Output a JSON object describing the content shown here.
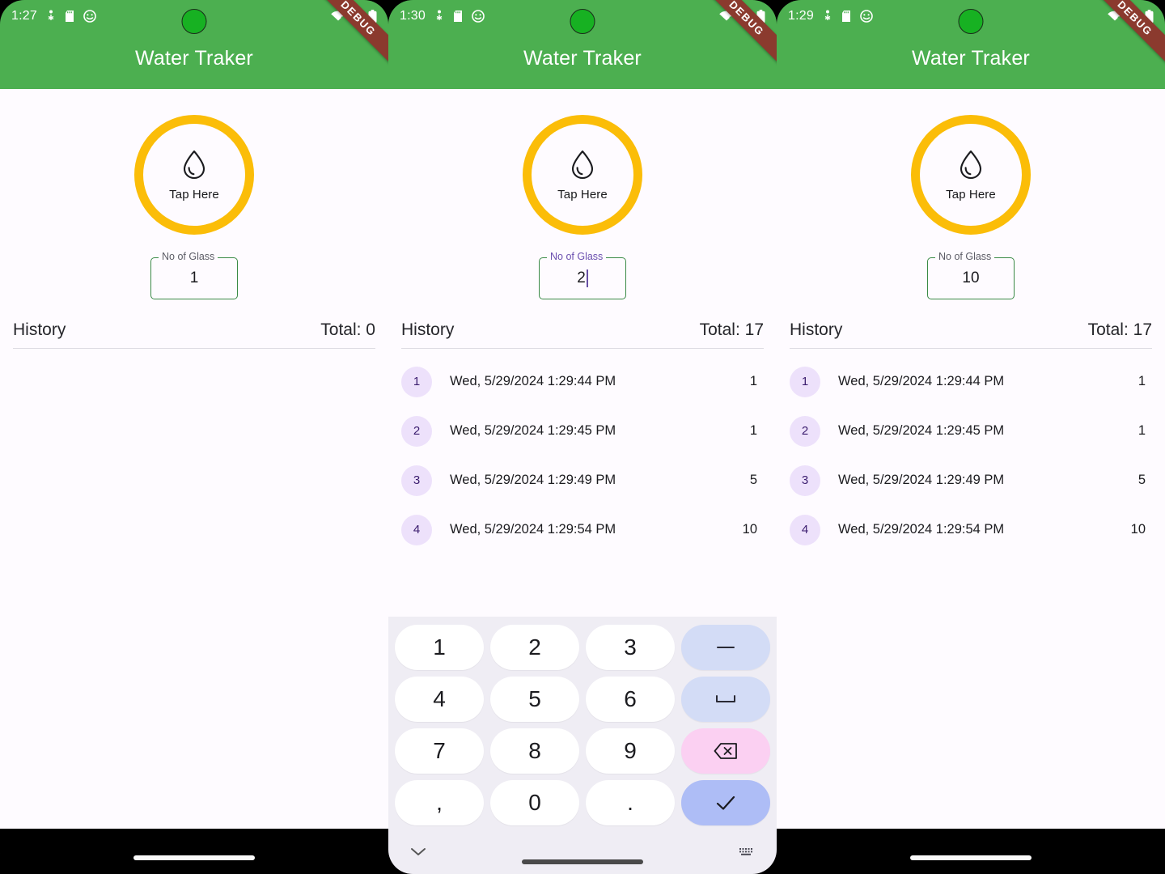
{
  "colors": {
    "appbar_green": "#4CAF50",
    "accent_yellow": "#FBBD08",
    "field_border_green": "#3A8A46",
    "focus_purple": "#6750A4",
    "badge_bg": "#EDE1FB",
    "page_bg": "#FEFBFF",
    "debug_ribbon": "#8B3A2E"
  },
  "app": {
    "title": "Water Traker",
    "debug_banner": "DEBUG",
    "tap_button_label": "Tap Here",
    "drop_icon": "water-drop-icon",
    "field_label": "No of Glass",
    "history_title": "History",
    "total_prefix": "Total: "
  },
  "panels": [
    {
      "status": {
        "time": "1:27",
        "icons": [
          "bluetooth-off-icon",
          "sd-card-icon",
          "emoji-icon"
        ],
        "right_icons": [
          "wifi-alert-icon",
          "signal-icon",
          "battery-icon"
        ]
      },
      "field_value": "1",
      "field_focused": false,
      "history_total": "Total: 0",
      "rows": [],
      "keyboard_visible": false
    },
    {
      "status": {
        "time": "1:30",
        "icons": [
          "bluetooth-off-icon",
          "sd-card-icon",
          "emoji-icon"
        ],
        "right_icons": [
          "wifi-alert-icon",
          "signal-icon",
          "battery-icon"
        ]
      },
      "field_value": "2",
      "field_focused": true,
      "history_total": "Total: 17",
      "rows": [
        {
          "index": "1",
          "date": "Wed, 5/29/2024 1:29:44 PM",
          "count": "1"
        },
        {
          "index": "2",
          "date": "Wed, 5/29/2024 1:29:45 PM",
          "count": "1"
        },
        {
          "index": "3",
          "date": "Wed, 5/29/2024 1:29:49 PM",
          "count": "5"
        },
        {
          "index": "4",
          "date": "Wed, 5/29/2024 1:29:54 PM",
          "count": "10"
        }
      ],
      "keyboard_visible": true
    },
    {
      "status": {
        "time": "1:29",
        "icons": [
          "bluetooth-off-icon",
          "sd-card-icon",
          "emoji-icon"
        ],
        "right_icons": [
          "wifi-alert-icon",
          "signal-icon",
          "battery-icon"
        ]
      },
      "field_value": "10",
      "field_focused": false,
      "history_total": "Total: 17",
      "rows": [
        {
          "index": "1",
          "date": "Wed, 5/29/2024 1:29:44 PM",
          "count": "1"
        },
        {
          "index": "2",
          "date": "Wed, 5/29/2024 1:29:45 PM",
          "count": "1"
        },
        {
          "index": "3",
          "date": "Wed, 5/29/2024 1:29:49 PM",
          "count": "5"
        },
        {
          "index": "4",
          "date": "Wed, 5/29/2024 1:29:54 PM",
          "count": "10"
        }
      ],
      "keyboard_visible": false
    }
  ],
  "keyboard": {
    "rows": [
      [
        {
          "label": "1",
          "name": "key-1",
          "kind": "num"
        },
        {
          "label": "2",
          "name": "key-2",
          "kind": "num"
        },
        {
          "label": "3",
          "name": "key-3",
          "kind": "num"
        },
        {
          "label": "–",
          "name": "key-minus",
          "kind": "fn"
        }
      ],
      [
        {
          "label": "4",
          "name": "key-4",
          "kind": "num"
        },
        {
          "label": "5",
          "name": "key-5",
          "kind": "num"
        },
        {
          "label": "6",
          "name": "key-6",
          "kind": "num"
        },
        {
          "label": "⌴",
          "name": "key-space",
          "kind": "fn"
        }
      ],
      [
        {
          "label": "7",
          "name": "key-7",
          "kind": "num"
        },
        {
          "label": "8",
          "name": "key-8",
          "kind": "num"
        },
        {
          "label": "9",
          "name": "key-9",
          "kind": "num"
        },
        {
          "label": "⌫",
          "name": "key-backspace",
          "kind": "del"
        }
      ],
      [
        {
          "label": ",",
          "name": "key-comma",
          "kind": "num"
        },
        {
          "label": "0",
          "name": "key-0",
          "kind": "num"
        },
        {
          "label": ".",
          "name": "key-period",
          "kind": "num"
        },
        {
          "label": "✓",
          "name": "key-enter",
          "kind": "ok"
        }
      ]
    ],
    "bottom": {
      "collapse_icon": "chevron-down-icon",
      "switch_icon": "keyboard-icon"
    }
  }
}
